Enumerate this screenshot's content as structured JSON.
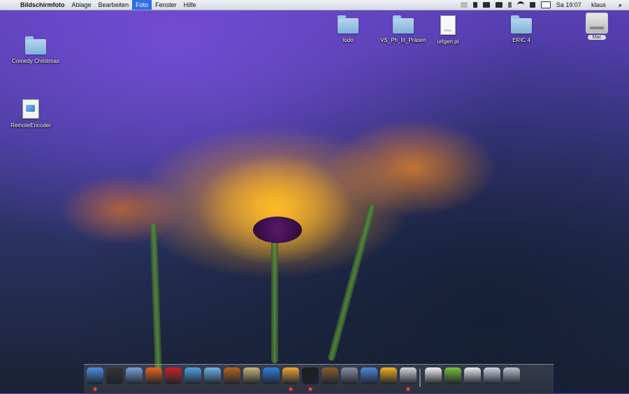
{
  "menubar": {
    "apple_label": "",
    "app_name": "Bildschirmfoto",
    "menus": [
      "Ablage",
      "Bearbeiten",
      "Foto",
      "Fenster",
      "Hilfe"
    ],
    "active_menu": "Foto",
    "clock": "Sa 19:07",
    "user": "klaus"
  },
  "desktop": {
    "left_icons": [
      {
        "label": "Comedy Christmas",
        "icon": "folder-icon"
      },
      {
        "label": "RemoteEncoder",
        "icon": "application-document-icon"
      }
    ],
    "top_icons": [
      {
        "label": "todo",
        "icon": "folder-icon"
      },
      {
        "label": "VS_Ph_III_Präsen",
        "icon": "folder-icon"
      },
      {
        "label": "urlgen.pl",
        "icon": "perl-document-icon",
        "tag": "PERL"
      },
      {
        "label": "ERIC 4",
        "icon": "folder-icon"
      }
    ],
    "drive": {
      "label": "Mac",
      "icon": "hard-drive-icon"
    }
  },
  "dock": {
    "items": [
      {
        "name": "finder-icon",
        "color": "#4a90e2",
        "running": true
      },
      {
        "name": "dashboard-icon",
        "color": "#333333",
        "running": false
      },
      {
        "name": "mail-icon",
        "color": "#7aa3d6",
        "running": false
      },
      {
        "name": "firefox-icon",
        "color": "#e8651a",
        "running": false
      },
      {
        "name": "app-red-star-icon",
        "color": "#cc2222",
        "running": false
      },
      {
        "name": "ichat-icon",
        "color": "#4fa3e0",
        "running": false
      },
      {
        "name": "itunes-icon",
        "color": "#6fb3e8",
        "running": false
      },
      {
        "name": "iphoto-icon",
        "color": "#b5651d",
        "running": false
      },
      {
        "name": "imovie-star-icon",
        "color": "#c9b37a",
        "running": false
      },
      {
        "name": "quicktime-icon",
        "color": "#2e7fd6",
        "running": false
      },
      {
        "name": "photo-app-icon",
        "color": "#f2a533",
        "running": true
      },
      {
        "name": "terminal-icon",
        "color": "#1b1b1b",
        "running": true
      },
      {
        "name": "keynote-icon",
        "color": "#8a5b2e",
        "running": false
      },
      {
        "name": "utility-icon",
        "color": "#8a8fa0",
        "running": false
      },
      {
        "name": "chart-app-icon",
        "color": "#4b88d8",
        "running": false
      },
      {
        "name": "network-app-icon",
        "color": "#f2b01e",
        "running": false
      },
      {
        "name": "screenshot-app-icon",
        "color": "#d8d8d8",
        "running": true
      },
      {
        "name": "document-icon",
        "color": "#f2f2f2",
        "running": false
      },
      {
        "name": "android-app-icon",
        "color": "#7bbf3a",
        "running": false
      },
      {
        "name": "text-document-icon",
        "color": "#ebebeb",
        "running": false
      },
      {
        "name": "window-app-icon",
        "color": "#cfd6df",
        "running": false
      },
      {
        "name": "trash-icon",
        "color": "#b9c1c9",
        "running": false
      }
    ]
  }
}
